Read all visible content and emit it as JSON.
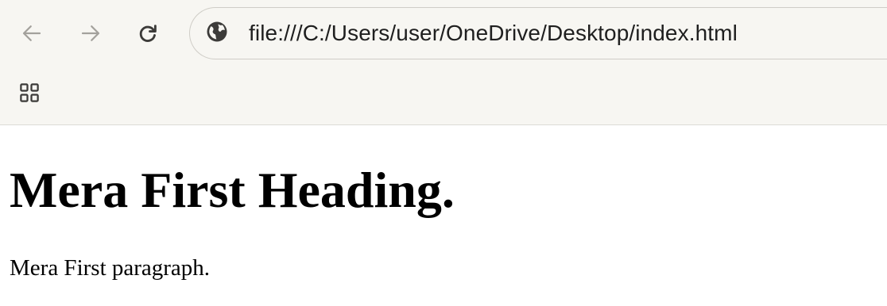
{
  "browser": {
    "url": "file:///C:/Users/user/OneDrive/Desktop/index.html",
    "icons": {
      "back": "arrow-left-icon",
      "forward": "arrow-right-icon",
      "reload": "reload-icon",
      "site_info": "globe-icon",
      "apps": "apps-grid-icon"
    }
  },
  "page": {
    "heading": "Mera First Heading.",
    "paragraph": "Mera First paragraph."
  },
  "colors": {
    "toolbar_bg": "#f7f6f2",
    "icon_gray": "#9a9893",
    "icon_dark": "#3c3b39"
  }
}
